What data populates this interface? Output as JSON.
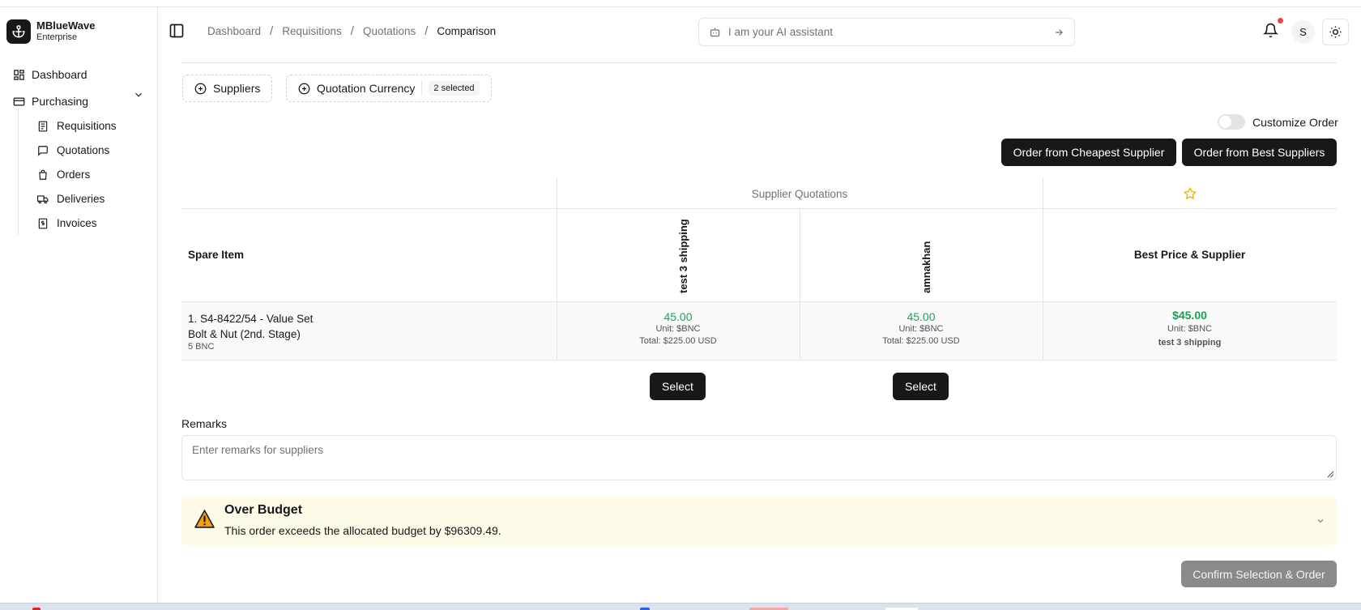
{
  "brand": {
    "name": "MBlueWave",
    "subtitle": "Enterprise"
  },
  "sidebar": {
    "dashboard": "Dashboard",
    "purchasing": "Purchasing",
    "items": [
      "Requisitions",
      "Quotations",
      "Orders",
      "Deliveries",
      "Invoices"
    ]
  },
  "breadcrumb": [
    "Dashboard",
    "Requisitions",
    "Quotations",
    "Comparison"
  ],
  "assistant": {
    "placeholder": "I am your AI assistant"
  },
  "user": {
    "initial": "S"
  },
  "filters": {
    "suppliers": "Suppliers",
    "currency": "Quotation Currency",
    "currency_badge": "2 selected"
  },
  "customize_label": "Customize Order",
  "actions": {
    "cheapest": "Order from Cheapest Supplier",
    "best": "Order from Best Suppliers"
  },
  "table": {
    "group_header": "Supplier Quotations",
    "spare_item_header": "Spare Item",
    "best_header": "Best Price & Supplier",
    "suppliers": [
      "test 3 shipping",
      "amnakhan"
    ],
    "row": {
      "name_line1": "1. S4-8422/54 - Value Set",
      "name_line2": "Bolt & Nut (2nd. Stage)",
      "qty": "5 BNC",
      "quotes": [
        {
          "price": "45.00",
          "unit": "Unit: $BNC",
          "total": "Total: $225.00 USD"
        },
        {
          "price": "45.00",
          "unit": "Unit: $BNC",
          "total": "Total: $225.00 USD"
        }
      ],
      "best": {
        "price": "$45.00",
        "unit": "Unit: $BNC",
        "supplier": "test 3 shipping"
      }
    },
    "select_label": "Select"
  },
  "remarks": {
    "label": "Remarks",
    "placeholder": "Enter remarks for suppliers"
  },
  "alert": {
    "title": "Over Budget",
    "message": "This order exceeds the allocated budget by $96309.49."
  },
  "confirm_label": "Confirm Selection & Order",
  "colors": {
    "price_green": "#22a05a",
    "alert_bg": "#fefce8",
    "warning_amber": "#f59e0b",
    "primary": "#18181b"
  },
  "icons": [
    "anchor-icon",
    "dashboard-icon",
    "card-icon",
    "chevron-down-icon",
    "receipt-icon",
    "message-icon",
    "bag-icon",
    "truck-icon",
    "invoice-icon",
    "sidebar-toggle-icon",
    "bot-icon",
    "arrow-right-icon",
    "bell-icon",
    "sun-icon",
    "plus-circle-icon",
    "star-icon",
    "warning-icon"
  ]
}
